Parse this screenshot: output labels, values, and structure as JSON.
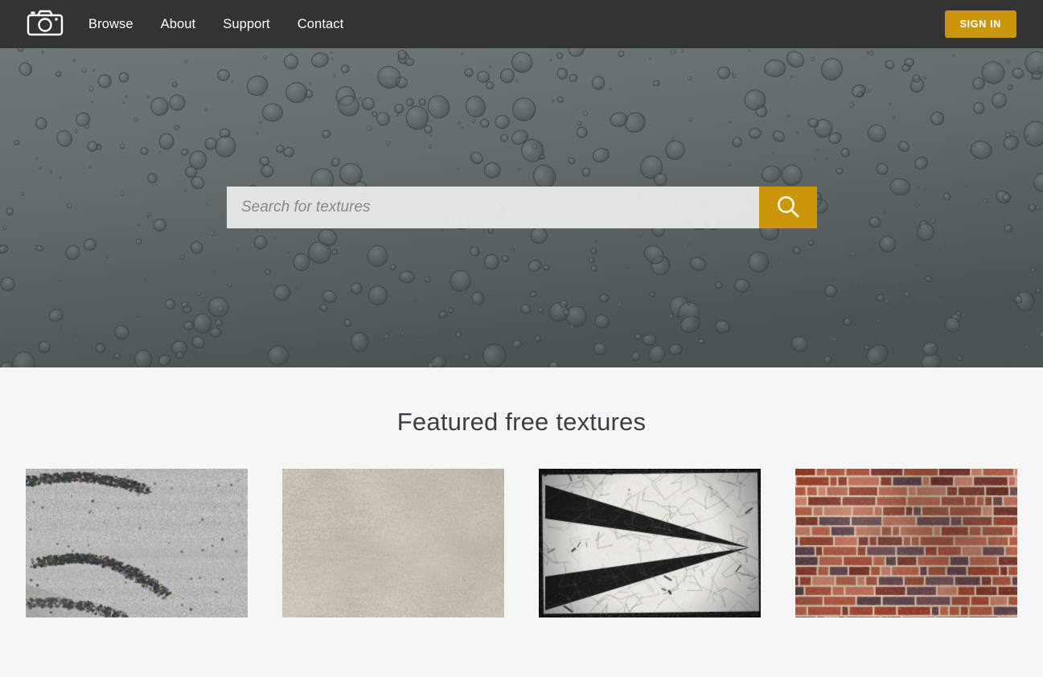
{
  "navbar": {
    "logo_icon": "camera-icon",
    "links": [
      {
        "label": "Browse"
      },
      {
        "label": "About"
      },
      {
        "label": "Support"
      },
      {
        "label": "Contact"
      }
    ],
    "signin_label": "SIGN IN",
    "background_color": "#333333",
    "accent_color": "#c9960c"
  },
  "hero": {
    "background_description": "water droplets on gray green glass",
    "background_color": "#626c6b",
    "search": {
      "value": "",
      "placeholder": "Search for textures",
      "button_icon": "search-icon",
      "button_color": "#c9960c"
    }
  },
  "featured": {
    "title": "Featured free textures",
    "background_color": "#f6f6f6",
    "thumbnails": [
      {
        "name": "gray-concrete-wall-texture",
        "palette": [
          "#b6b7b5",
          "#cfd0ce",
          "#8e8f8d",
          "#5f605e"
        ]
      },
      {
        "name": "beige-sand-leather-texture",
        "palette": [
          "#c8c0b4",
          "#d6cfc4",
          "#b5ac9f",
          "#9c9286"
        ]
      },
      {
        "name": "black-arrow-on-cracked-white-paint-texture",
        "palette": [
          "#1b1b1b",
          "#e9e9e5",
          "#2a2a2a",
          "#cfcfc9"
        ]
      },
      {
        "name": "red-brick-wall-texture",
        "palette": [
          "#a84a34",
          "#c2705a",
          "#e5d5c0",
          "#6e4a52"
        ]
      }
    ]
  }
}
